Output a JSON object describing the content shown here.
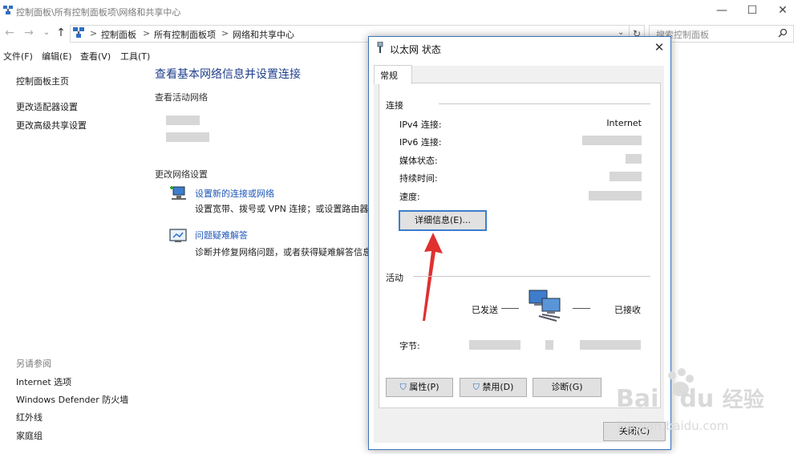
{
  "window": {
    "title": "控制面板\\所有控制面板项\\网络和共享中心",
    "controls": {
      "min": "—",
      "max": "☐",
      "close": "✕"
    }
  },
  "address": {
    "crumbs": [
      "控制面板",
      "所有控制面板项",
      "网络和共享中心"
    ],
    "separator": ">",
    "search_placeholder": "搜索控制面板"
  },
  "menu": [
    "文件(F)",
    "编辑(E)",
    "查看(V)",
    "工具(T)"
  ],
  "sidebar": {
    "items": [
      "控制面板主页",
      "更改适配器设置",
      "更改高级共享设置"
    ],
    "see_also_heading": "另请参阅",
    "see_also": [
      "Internet 选项",
      "Windows Defender 防火墙",
      "红外线",
      "家庭组"
    ]
  },
  "main": {
    "title": "查看基本网络信息并设置连接",
    "active_networks_heading": "查看活动网络",
    "change_settings_heading": "更改网络设置",
    "tasks": [
      {
        "link": "设置新的连接或网络",
        "desc": "设置宽带、拨号或 VPN 连接；或设置路由器或接入点。"
      },
      {
        "link": "问题疑难解答",
        "desc": "诊断并修复网络问题，或者获得疑难解答信息。"
      }
    ]
  },
  "dialog": {
    "title": "以太网 状态",
    "tab": "常规",
    "connection_group": "连接",
    "rows": [
      {
        "label": "IPv4 连接:",
        "value": "Internet"
      },
      {
        "label": "IPv6 连接:",
        "value": ""
      },
      {
        "label": "媒体状态:",
        "value": ""
      },
      {
        "label": "持续时间:",
        "value": ""
      },
      {
        "label": "速度:",
        "value": ""
      }
    ],
    "details_button": "详细信息(E)...",
    "activity_group": "活动",
    "sent_label": "已发送",
    "received_label": "已接收",
    "bytes_label": "字节:",
    "buttons": [
      "属性(P)",
      "禁用(D)",
      "诊断(G)"
    ],
    "close_button": "关闭(C)"
  },
  "watermark": {
    "brand": "Bai",
    "brand2": "du",
    "cn": "经验",
    "url": "jingyan.baidu.com"
  },
  "colors": {
    "accent": "#3c73b8",
    "link": "#1f57b8",
    "title": "#1e3f8a",
    "arrow": "#e03030"
  }
}
